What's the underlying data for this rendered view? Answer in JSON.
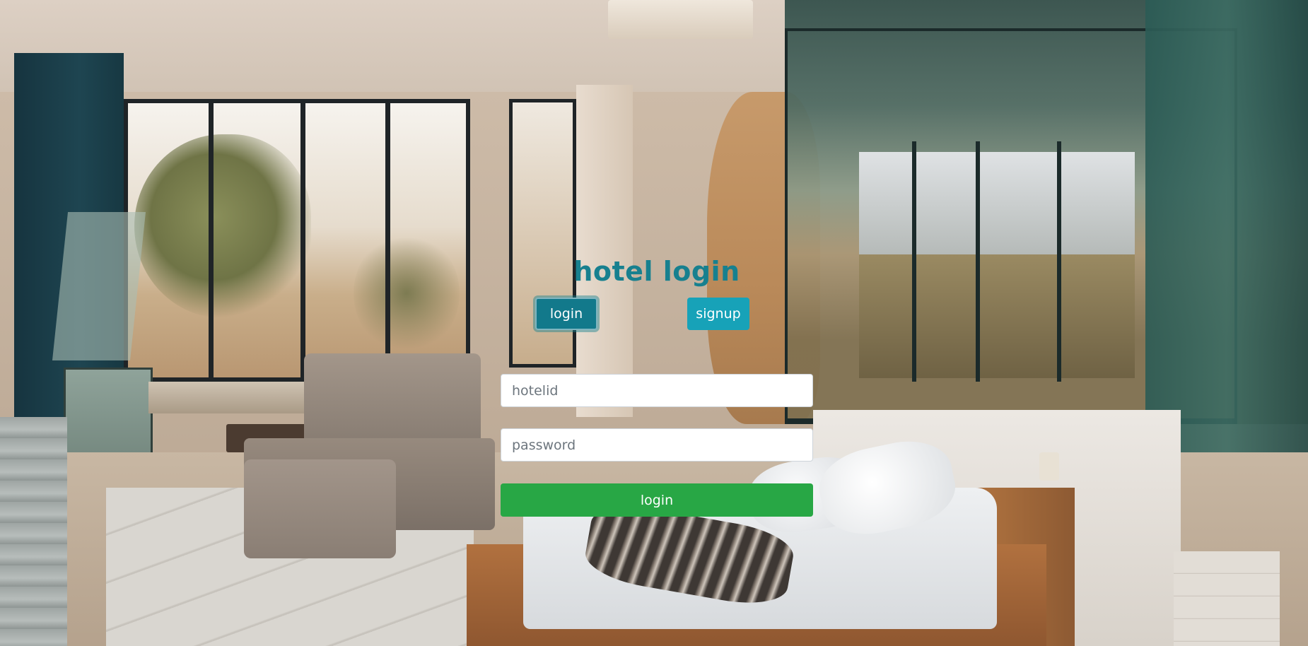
{
  "page": {
    "title": "hotel login",
    "background": "hotel-room-photo",
    "colors": {
      "title": "#17808f",
      "tab_active": "#12798b",
      "tab_inactive": "#17a2b8",
      "submit": "#28a745"
    }
  },
  "tabs": {
    "login_label": "login",
    "signup_label": "signup",
    "active": "login"
  },
  "form": {
    "hotelid": {
      "value": "",
      "placeholder": "hotelid"
    },
    "password": {
      "value": "",
      "placeholder": "password"
    },
    "submit_label": "login"
  }
}
